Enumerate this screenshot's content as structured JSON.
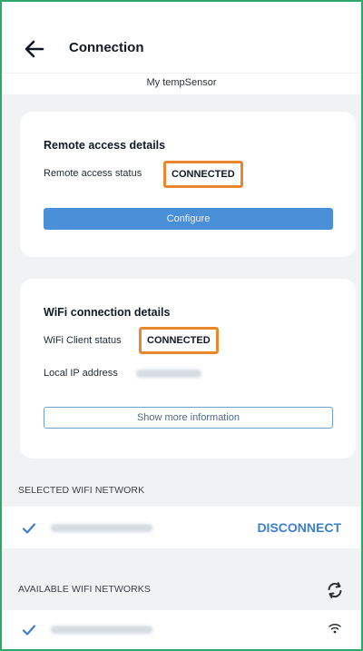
{
  "header": {
    "title": "Connection",
    "device_name": "My tempSensor"
  },
  "remote_card": {
    "title": "Remote access details",
    "status_label": "Remote access status",
    "status_value": "CONNECTED",
    "configure_label": "Configure"
  },
  "wifi_card": {
    "title": "WiFi connection details",
    "client_status_label": "WiFi Client status",
    "client_status_value": "CONNECTED",
    "ip_label": "Local IP address",
    "more_info_label": "Show more information"
  },
  "selected_network": {
    "section_label": "SELECTED WIFI NETWORK",
    "disconnect_label": "DISCONNECT"
  },
  "available_networks": {
    "section_label": "AVAILABLE WIFI NETWORKS"
  },
  "icons": {
    "back": "arrow-left-icon",
    "check": "checkmark-icon",
    "refresh": "refresh-icon",
    "wifi": "wifi-signal-icon"
  },
  "colors": {
    "accent": "#3b7fd0",
    "highlight_box": "#e8872b",
    "frame_border": "#2fa66b",
    "button_fill": "#4a90d9"
  }
}
